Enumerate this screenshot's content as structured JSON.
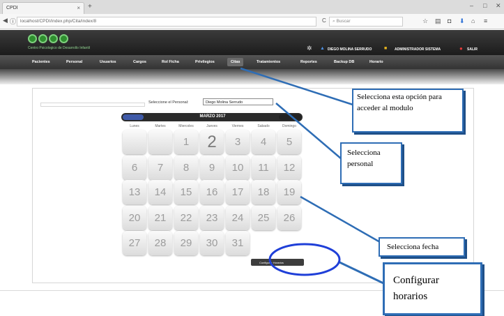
{
  "browser": {
    "tab_title": "CPDI",
    "tab_close": "×",
    "new_tab": "+",
    "url": "localhost/CPDI/index.php/Cita/index/8",
    "search_placeholder": "Buscar",
    "reload": "C"
  },
  "header": {
    "logo_text": "Centro Psicologico de Desarrollo Infantil",
    "user_name": "DIEGO MOLINA SERRUDO",
    "user_role": "ADMINISTRADOR SISTEMA",
    "logout": "SALIR"
  },
  "nav": {
    "items": [
      "Pacientes",
      "Personal",
      "Usuarios",
      "Cargos",
      "Rol Ficha",
      "Privilegios",
      "Citas",
      "Tratamientos",
      "Reportes",
      "Backup DB",
      "Horario"
    ],
    "active": "Citas"
  },
  "form": {
    "personal_label": "Seleccione el Personal:",
    "personal_value": "Diego Molina Serrudo"
  },
  "calendar": {
    "month": "MARZO 2017",
    "weekdays": [
      "Lunes",
      "Martes",
      "Miercoles",
      "Jueves",
      "Viernes",
      "Sabado",
      "Domingo"
    ],
    "weeks": [
      [
        "",
        "",
        "1",
        "2",
        "3",
        "4",
        "5"
      ],
      [
        "6",
        "7",
        "8",
        "9",
        "10",
        "11",
        "12"
      ],
      [
        "13",
        "14",
        "15",
        "16",
        "17",
        "18",
        "19"
      ],
      [
        "20",
        "21",
        "22",
        "23",
        "24",
        "25",
        "26"
      ],
      [
        "27",
        "28",
        "29",
        "30",
        "31",
        "",
        ""
      ]
    ],
    "config_button": "Configurar Horarios"
  },
  "callouts": {
    "option": "Selecciona esta opción para acceder al modulo",
    "personal": "Selecciona personal",
    "date": "Selecciona fecha",
    "config": "Configurar horarios"
  },
  "colors": {
    "accent": "#2e6db5",
    "header": "#1c1c1c",
    "logo_green": "#2f8f2f"
  }
}
